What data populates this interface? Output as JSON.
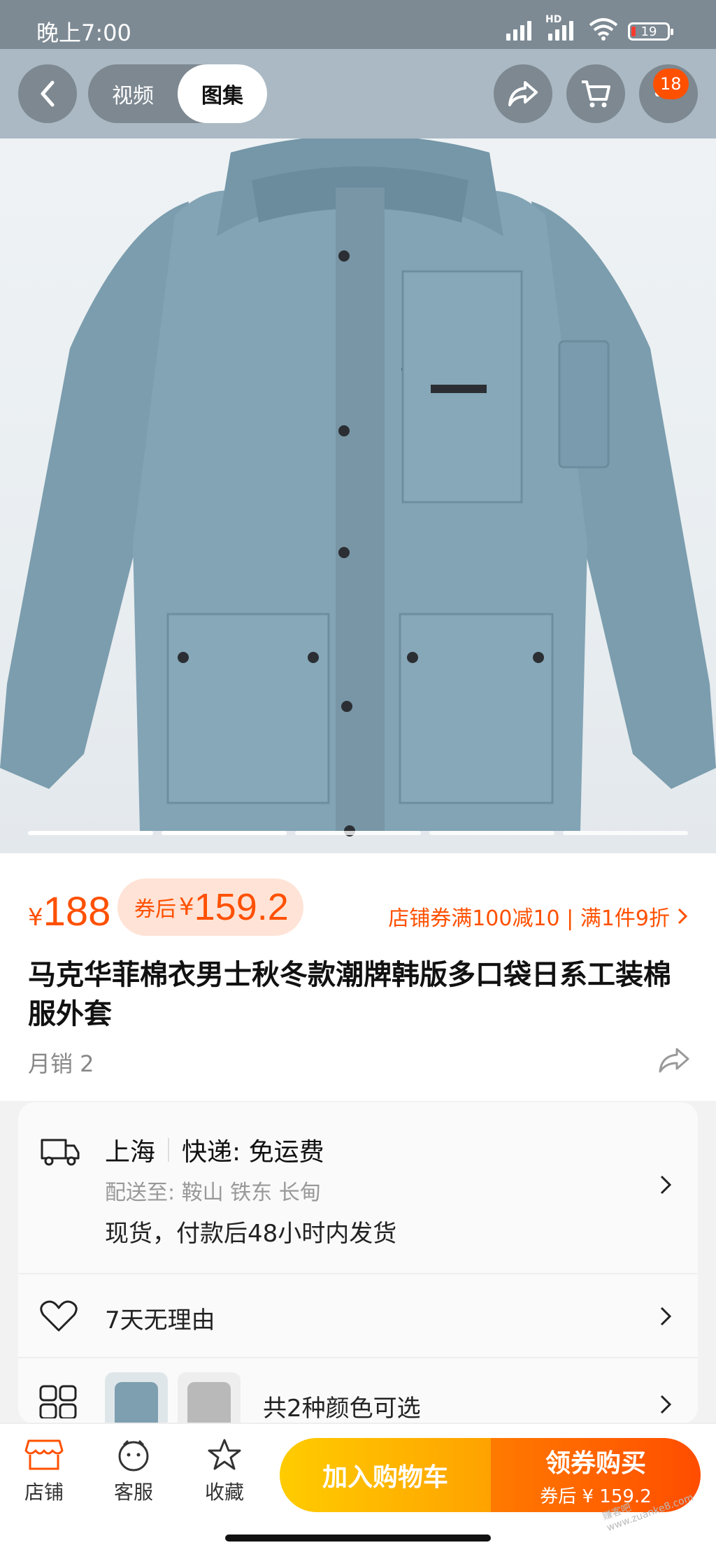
{
  "status": {
    "time": "晚上7:00",
    "hd": "HD",
    "battery": "19"
  },
  "nav": {
    "tabs": [
      {
        "label": "视频"
      },
      {
        "label": "图集"
      }
    ],
    "cart_badge": "18"
  },
  "product": {
    "price_currency": "¥",
    "price": "188",
    "coupon_label": "券后",
    "coupon_currency": "¥",
    "coupon_price": "159.2",
    "promo": "店铺券满100减10 | 满1件9折",
    "title": "马克华菲棉衣男士秋冬款潮牌韩版多口袋日系工装棉服外套",
    "sales": "月销 2",
    "image_color": "#7d9fb0"
  },
  "service": {
    "origin": "上海",
    "express": "快递: 免运费",
    "deliver_to": "配送至: 鞍山 铁东 长甸",
    "stock": "现货，付款后48小时内发货",
    "return_policy": "7天无理由",
    "colors": "共2种颜色可选"
  },
  "bottom": {
    "shop": "店铺",
    "service": "客服",
    "favorite": "收藏",
    "add_cart": "加入购物车",
    "buy": "领券购买",
    "buy_sub": "券后 ¥ 159.2"
  },
  "colors": {
    "accent": "#ff5000",
    "cart_button": "#ffb800",
    "buy_button": "#ff5a00"
  },
  "watermark": "赚客吧 www.zuanke8.com"
}
